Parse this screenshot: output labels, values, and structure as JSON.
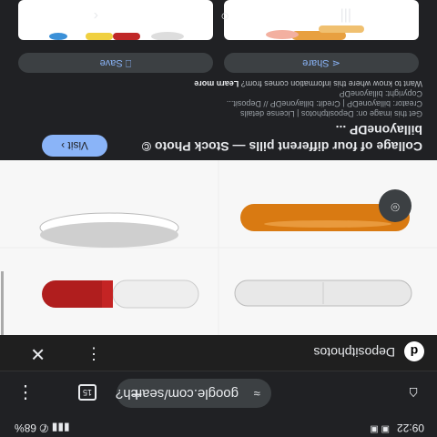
{
  "status_bar": {
    "time": "09:22",
    "notification_icons": "▣ ▣",
    "battery": "68%",
    "signal": "▮▮▮ ✆"
  },
  "browser": {
    "home_icon": "⌂",
    "url": "google.com/search?",
    "tune_icon": "≈",
    "new_tab_icon": "+",
    "tab_count": "15",
    "menu_icon": "⋮"
  },
  "site_bar": {
    "favicon_letter": "d",
    "site_name": "Depositphotos",
    "menu_icon": "⋮",
    "close_icon": "✕"
  },
  "lens_icon": "⌾",
  "result": {
    "title": "Collage of four different pills — Stock Photo © billayoneDP ...",
    "visit_label": "Visit",
    "visit_icon": "›",
    "get_image_line": "Get this image on: Depositphotos | License details",
    "creator_line": "Creator: billayoneDP | Credit: billayoneDP // Deposit...",
    "copyright_line": "Copyright: billayoneDP",
    "want_to_know": "Want to know where this information comes from?",
    "learn_more": "Learn more"
  },
  "actions": {
    "share_label": "Share",
    "share_icon": "⋖",
    "save_label": "Save",
    "save_icon": "⎕"
  },
  "nav_bar": {
    "recents_icon": "|||",
    "home_icon": "○",
    "back_icon": "‹"
  },
  "colors": {
    "accent": "#8ab4f8",
    "background": "#202124",
    "surface": "#3c4043"
  }
}
